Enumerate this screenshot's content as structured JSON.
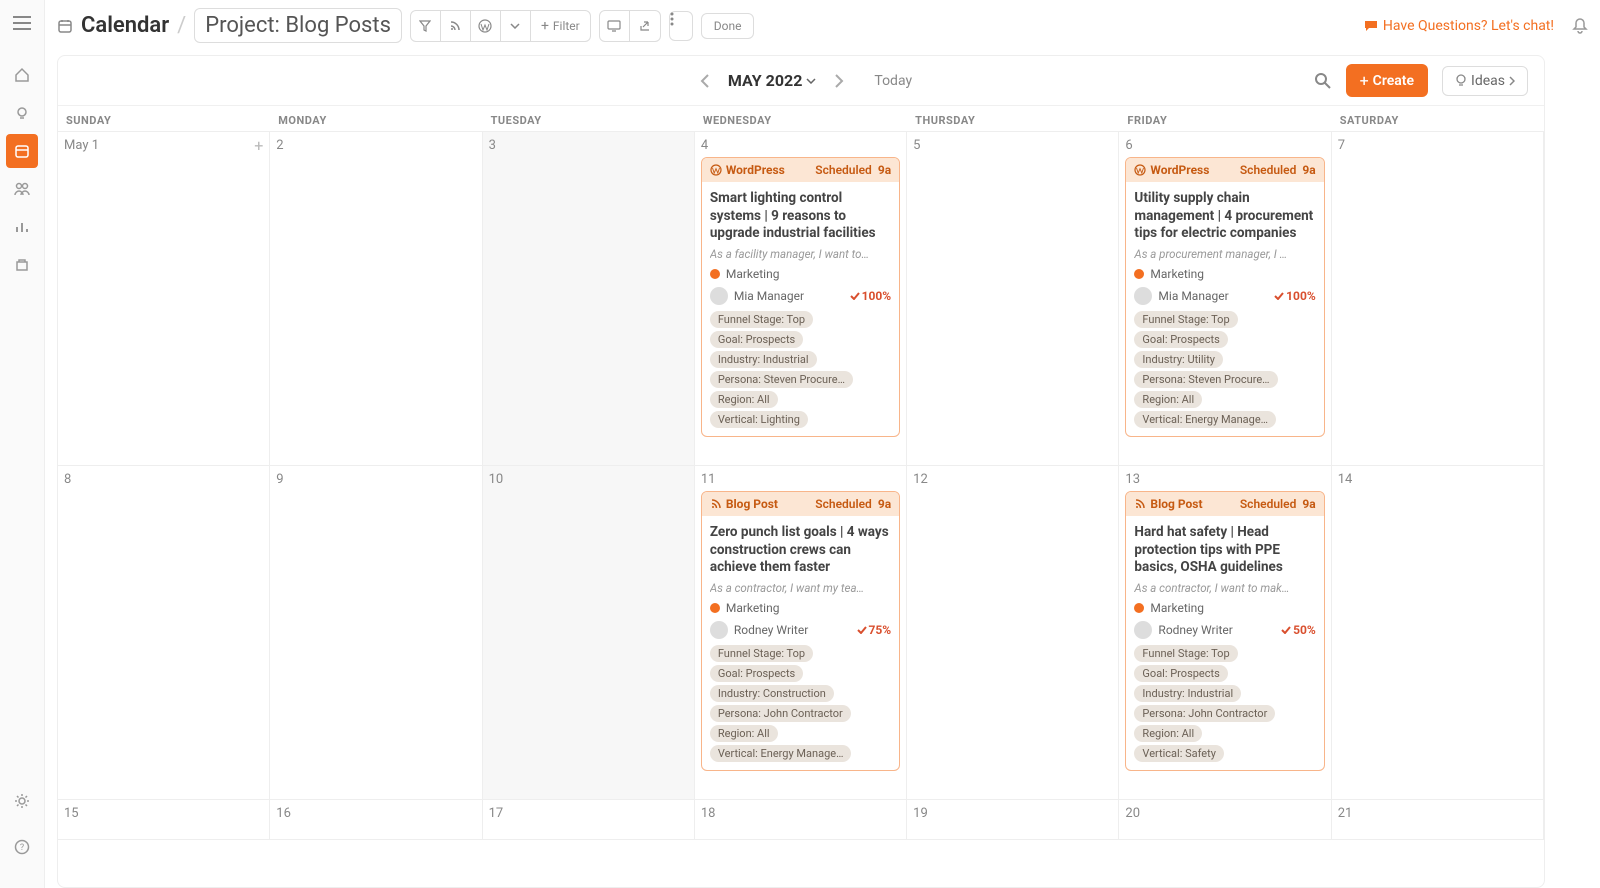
{
  "header": {
    "title": "Calendar",
    "project": "Project: Blog Posts",
    "filter_label": "Filter",
    "done_label": "Done",
    "chat_label": "Have Questions? Let's chat!"
  },
  "calendar": {
    "month_label": "MAY 2022",
    "today_label": "Today",
    "create_label": "Create",
    "ideas_label": "Ideas",
    "day_names": [
      "SUNDAY",
      "MONDAY",
      "TUESDAY",
      "WEDNESDAY",
      "THURSDAY",
      "FRIDAY",
      "SATURDAY"
    ],
    "dates": [
      [
        "May 1",
        "2",
        "3",
        "4",
        "5",
        "6",
        "7"
      ],
      [
        "8",
        "9",
        "10",
        "11",
        "12",
        "13",
        "14"
      ],
      [
        "15",
        "16",
        "17",
        "18",
        "19",
        "20",
        "21"
      ]
    ]
  },
  "cards": {
    "c0": {
      "type": "WordPress",
      "status": "Scheduled",
      "time": "9a",
      "title": "Smart lighting control systems | 9 reasons to upgrade industrial facilities",
      "desc": "As a facility manager, I want to…",
      "category": "Marketing",
      "owner": "Mia Manager",
      "percent": "100%",
      "tags": [
        "Funnel Stage: Top",
        "Goal: Prospects",
        "Industry: Industrial",
        "Persona: Steven Procure…",
        "Region: All",
        "Vertical: Lighting"
      ]
    },
    "c1": {
      "type": "WordPress",
      "status": "Scheduled",
      "time": "9a",
      "title": "Utility supply chain management | 4 procurement tips for electric companies",
      "desc": "As a procurement manager, I …",
      "category": "Marketing",
      "owner": "Mia Manager",
      "percent": "100%",
      "tags": [
        "Funnel Stage: Top",
        "Goal: Prospects",
        "Industry: Utility",
        "Persona: Steven Procure…",
        "Region: All",
        "Vertical: Energy Manage…"
      ]
    },
    "c2": {
      "type": "Blog Post",
      "status": "Scheduled",
      "time": "9a",
      "title": "Zero punch list goals | 4 ways construction crews can achieve them faster",
      "desc": "As a contractor, I want my tea…",
      "category": "Marketing",
      "owner": "Rodney Writer",
      "percent": "75%",
      "tags": [
        "Funnel Stage: Top",
        "Goal: Prospects",
        "Industry: Construction",
        "Persona: John Contractor",
        "Region: All",
        "Vertical: Energy Manage…"
      ]
    },
    "c3": {
      "type": "Blog Post",
      "status": "Scheduled",
      "time": "9a",
      "title": "Hard hat safety | Head protection tips with PPE basics, OSHA guidelines",
      "desc": "As a contractor, I want to mak…",
      "category": "Marketing",
      "owner": "Rodney Writer",
      "percent": "50%",
      "tags": [
        "Funnel Stage: Top",
        "Goal: Prospects",
        "Industry: Industrial",
        "Persona: John Contractor",
        "Region: All",
        "Vertical: Safety"
      ]
    }
  }
}
